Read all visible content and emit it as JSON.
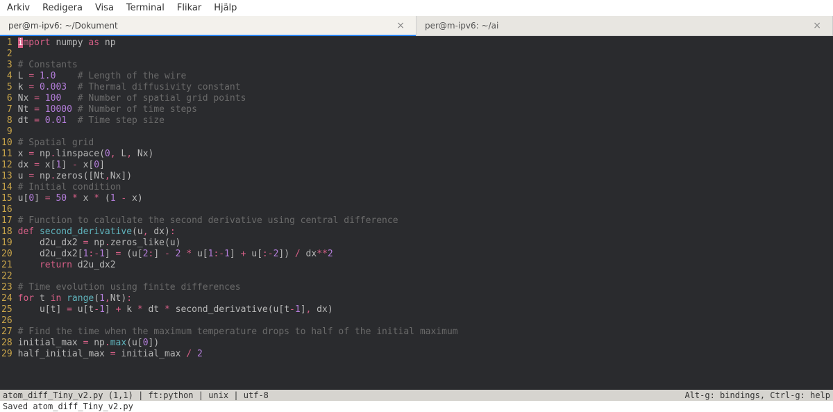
{
  "menubar": {
    "items": [
      "Arkiv",
      "Redigera",
      "Visa",
      "Terminal",
      "Flikar",
      "Hjälp"
    ]
  },
  "tabs": [
    {
      "title": "per@m-ipv6: ~/Dokument",
      "active": true
    },
    {
      "title": "per@m-ipv6: ~/ai",
      "active": false
    }
  ],
  "status": {
    "left": "atom_diff_Tiny_v2.py (1,1) | ft:python | unix | utf-8",
    "right": "Alt-g: bindings, Ctrl-g: help"
  },
  "message": "Saved atom_diff_Tiny_v2.py",
  "code": {
    "lines": [
      {
        "n": 1,
        "tokens": [
          [
            "cur",
            "i"
          ],
          [
            "kw",
            "mport"
          ],
          [
            "id",
            " numpy "
          ],
          [
            "kw",
            "as"
          ],
          [
            "id",
            " np"
          ]
        ]
      },
      {
        "n": 2,
        "tokens": []
      },
      {
        "n": 3,
        "tokens": [
          [
            "cmt",
            "# Constants"
          ]
        ]
      },
      {
        "n": 4,
        "tokens": [
          [
            "id",
            "L "
          ],
          [
            "op",
            "="
          ],
          [
            "id",
            " "
          ],
          [
            "num",
            "1.0"
          ],
          [
            "id",
            "    "
          ],
          [
            "cmt",
            "# Length of the wire"
          ]
        ]
      },
      {
        "n": 5,
        "tokens": [
          [
            "id",
            "k "
          ],
          [
            "op",
            "="
          ],
          [
            "id",
            " "
          ],
          [
            "num",
            "0.003"
          ],
          [
            "id",
            "  "
          ],
          [
            "cmt",
            "# Thermal diffusivity constant"
          ]
        ]
      },
      {
        "n": 6,
        "tokens": [
          [
            "id",
            "Nx "
          ],
          [
            "op",
            "="
          ],
          [
            "id",
            " "
          ],
          [
            "num",
            "100"
          ],
          [
            "id",
            "   "
          ],
          [
            "cmt",
            "# Number of spatial grid points"
          ]
        ]
      },
      {
        "n": 7,
        "tokens": [
          [
            "id",
            "Nt "
          ],
          [
            "op",
            "="
          ],
          [
            "id",
            " "
          ],
          [
            "num",
            "10000"
          ],
          [
            "id",
            " "
          ],
          [
            "cmt",
            "# Number of time steps"
          ]
        ]
      },
      {
        "n": 8,
        "tokens": [
          [
            "id",
            "dt "
          ],
          [
            "op",
            "="
          ],
          [
            "id",
            " "
          ],
          [
            "num",
            "0.01"
          ],
          [
            "id",
            "  "
          ],
          [
            "cmt",
            "# Time step size"
          ]
        ]
      },
      {
        "n": 9,
        "tokens": []
      },
      {
        "n": 10,
        "tokens": [
          [
            "cmt",
            "# Spatial grid"
          ]
        ]
      },
      {
        "n": 11,
        "tokens": [
          [
            "id",
            "x "
          ],
          [
            "op",
            "="
          ],
          [
            "id",
            " np"
          ],
          [
            "op",
            "."
          ],
          [
            "id",
            "linspace("
          ],
          [
            "num",
            "0"
          ],
          [
            "op",
            ","
          ],
          [
            "id",
            " L"
          ],
          [
            "op",
            ","
          ],
          [
            "id",
            " Nx)"
          ]
        ]
      },
      {
        "n": 12,
        "tokens": [
          [
            "id",
            "dx "
          ],
          [
            "op",
            "="
          ],
          [
            "id",
            " x["
          ],
          [
            "num",
            "1"
          ],
          [
            "id",
            "] "
          ],
          [
            "op",
            "-"
          ],
          [
            "id",
            " x["
          ],
          [
            "num",
            "0"
          ],
          [
            "id",
            "]"
          ]
        ]
      },
      {
        "n": 13,
        "tokens": [
          [
            "id",
            "u "
          ],
          [
            "op",
            "="
          ],
          [
            "id",
            " np"
          ],
          [
            "op",
            "."
          ],
          [
            "id",
            "zeros([Nt"
          ],
          [
            "op",
            ","
          ],
          [
            "id",
            "Nx])"
          ]
        ]
      },
      {
        "n": 14,
        "tokens": [
          [
            "cmt",
            "# Initial condition"
          ]
        ]
      },
      {
        "n": 15,
        "tokens": [
          [
            "id",
            "u["
          ],
          [
            "num",
            "0"
          ],
          [
            "id",
            "] "
          ],
          [
            "op",
            "="
          ],
          [
            "id",
            " "
          ],
          [
            "num",
            "50"
          ],
          [
            "id",
            " "
          ],
          [
            "op",
            "*"
          ],
          [
            "id",
            " x "
          ],
          [
            "op",
            "*"
          ],
          [
            "id",
            " ("
          ],
          [
            "num",
            "1"
          ],
          [
            "id",
            " "
          ],
          [
            "op",
            "-"
          ],
          [
            "id",
            " x)"
          ]
        ]
      },
      {
        "n": 16,
        "tokens": []
      },
      {
        "n": 17,
        "tokens": [
          [
            "cmt",
            "# Function to calculate the second derivative using central difference"
          ]
        ]
      },
      {
        "n": 18,
        "tokens": [
          [
            "kw",
            "def"
          ],
          [
            "id",
            " "
          ],
          [
            "fn",
            "second_derivative"
          ],
          [
            "id",
            "(u"
          ],
          [
            "op",
            ","
          ],
          [
            "id",
            " dx)"
          ],
          [
            "op",
            ":"
          ]
        ]
      },
      {
        "n": 19,
        "tokens": [
          [
            "id",
            "    d2u_dx2 "
          ],
          [
            "op",
            "="
          ],
          [
            "id",
            " np"
          ],
          [
            "op",
            "."
          ],
          [
            "id",
            "zeros_like(u)"
          ]
        ]
      },
      {
        "n": 20,
        "tokens": [
          [
            "id",
            "    d2u_dx2["
          ],
          [
            "num",
            "1"
          ],
          [
            "op",
            ":"
          ],
          [
            "op",
            "-"
          ],
          [
            "num",
            "1"
          ],
          [
            "id",
            "] "
          ],
          [
            "op",
            "="
          ],
          [
            "id",
            " (u["
          ],
          [
            "num",
            "2"
          ],
          [
            "op",
            ":"
          ],
          [
            "id",
            "] "
          ],
          [
            "op",
            "-"
          ],
          [
            "id",
            " "
          ],
          [
            "num",
            "2"
          ],
          [
            "id",
            " "
          ],
          [
            "op",
            "*"
          ],
          [
            "id",
            " u["
          ],
          [
            "num",
            "1"
          ],
          [
            "op",
            ":"
          ],
          [
            "op",
            "-"
          ],
          [
            "num",
            "1"
          ],
          [
            "id",
            "] "
          ],
          [
            "op",
            "+"
          ],
          [
            "id",
            " u["
          ],
          [
            "op",
            ":"
          ],
          [
            "op",
            "-"
          ],
          [
            "num",
            "2"
          ],
          [
            "id",
            "]) "
          ],
          [
            "op",
            "/"
          ],
          [
            "id",
            " dx"
          ],
          [
            "op",
            "**"
          ],
          [
            "num",
            "2"
          ]
        ]
      },
      {
        "n": 21,
        "tokens": [
          [
            "id",
            "    "
          ],
          [
            "kw",
            "return"
          ],
          [
            "id",
            " d2u_dx2"
          ]
        ]
      },
      {
        "n": 22,
        "tokens": []
      },
      {
        "n": 23,
        "tokens": [
          [
            "cmt",
            "# Time evolution using finite differences"
          ]
        ]
      },
      {
        "n": 24,
        "tokens": [
          [
            "kw",
            "for"
          ],
          [
            "id",
            " t "
          ],
          [
            "kw",
            "in"
          ],
          [
            "id",
            " "
          ],
          [
            "fn",
            "range"
          ],
          [
            "id",
            "("
          ],
          [
            "num",
            "1"
          ],
          [
            "op",
            ","
          ],
          [
            "id",
            "Nt)"
          ],
          [
            "op",
            ":"
          ]
        ]
      },
      {
        "n": 25,
        "tokens": [
          [
            "id",
            "    u[t] "
          ],
          [
            "op",
            "="
          ],
          [
            "id",
            " u[t"
          ],
          [
            "op",
            "-"
          ],
          [
            "num",
            "1"
          ],
          [
            "id",
            "] "
          ],
          [
            "op",
            "+"
          ],
          [
            "id",
            " k "
          ],
          [
            "op",
            "*"
          ],
          [
            "id",
            " dt "
          ],
          [
            "op",
            "*"
          ],
          [
            "id",
            " second_derivative(u[t"
          ],
          [
            "op",
            "-"
          ],
          [
            "num",
            "1"
          ],
          [
            "id",
            "]"
          ],
          [
            "op",
            ","
          ],
          [
            "id",
            " dx)"
          ]
        ]
      },
      {
        "n": 26,
        "tokens": []
      },
      {
        "n": 27,
        "tokens": [
          [
            "cmt",
            "# Find the time when the maximum temperature drops to half of the initial maximum"
          ]
        ]
      },
      {
        "n": 28,
        "tokens": [
          [
            "id",
            "initial_max "
          ],
          [
            "op",
            "="
          ],
          [
            "id",
            " np"
          ],
          [
            "op",
            "."
          ],
          [
            "fn",
            "max"
          ],
          [
            "id",
            "(u["
          ],
          [
            "num",
            "0"
          ],
          [
            "id",
            "])"
          ]
        ]
      },
      {
        "n": 29,
        "tokens": [
          [
            "id",
            "half_initial_max "
          ],
          [
            "op",
            "="
          ],
          [
            "id",
            " initial_max "
          ],
          [
            "op",
            "/"
          ],
          [
            "id",
            " "
          ],
          [
            "num",
            "2"
          ]
        ]
      }
    ]
  }
}
